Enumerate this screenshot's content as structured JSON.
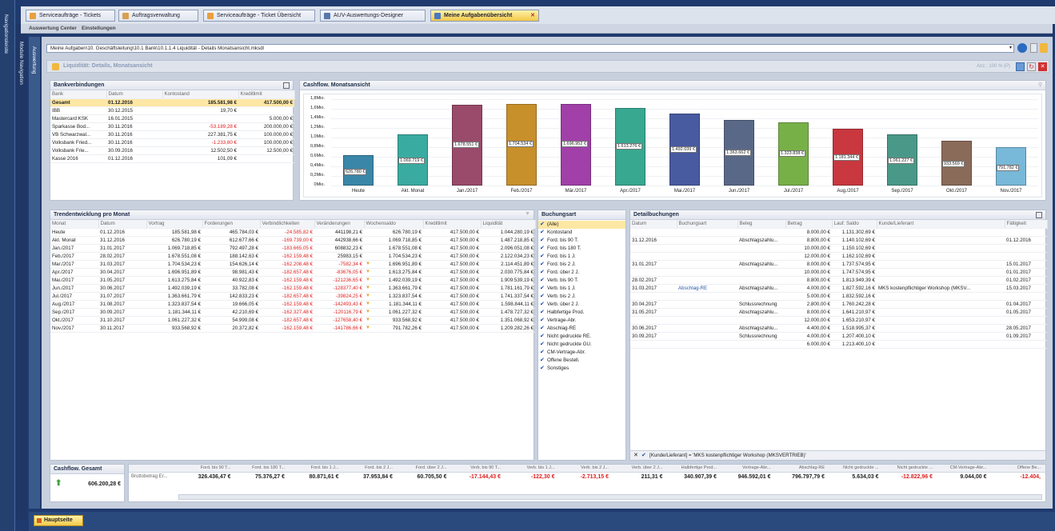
{
  "tabs": [
    {
      "label": "Serviceaufträge - Tickets",
      "color": "#e8a040"
    },
    {
      "label": "Auftragsverwaltung",
      "color": "#d8a050"
    },
    {
      "label": "Serviceaufträge - Ticket Übersicht",
      "color": "#e8a040"
    },
    {
      "label": "AUV-Auswertungs-Designer",
      "color": "#5577aa"
    },
    {
      "label": "Meine Aufgabenübersicht",
      "color": "#4a78c0"
    }
  ],
  "menu": [
    "Auswertung Center",
    "Einstellungen"
  ],
  "side": {
    "left": "Navigationsleiste",
    "mid": "Module Navigation",
    "inner": "Auswertung"
  },
  "path": "Meine Aufgaben\\10. Geschäftsleitung\\10.1 Bank\\10.1.1.4 Liquidität - Details Monatsansicht.mksdl",
  "report_title": "Liquidität: Details, Monatsansicht",
  "toolbar_zoom": "Anz.: 100 % (P)",
  "bank": {
    "title": "Bankverbindungen",
    "cols": [
      "Bank",
      "Datum",
      "Kontostand",
      "Kreditlimit"
    ],
    "rows": [
      [
        "Gesamt",
        "01.12.2016",
        "185.581,98 €",
        "417.500,00 €"
      ],
      [
        "IBB",
        "30.12.2015",
        "19,70 €",
        ""
      ],
      [
        "Mastercard KSK",
        "16.01.2015",
        "",
        "5.000,00 €"
      ],
      [
        "Sparkasse Bod...",
        "30.11.2016",
        "-53.189,28 €",
        "200.000,00 €"
      ],
      [
        "VB Schwarzwal...",
        "30.11.2016",
        "227.381,75 €",
        "100.000,00 €"
      ],
      [
        "Volksbank Fried...",
        "30.11.2016",
        "-1.233,60 €",
        "100.000,00 €"
      ],
      [
        "Volksbank Frie...",
        "30.09.2016",
        "12.502,50 €",
        "12.500,00 €"
      ],
      [
        "Kasse 2016",
        "01.12.2016",
        "101,09 €",
        ""
      ]
    ]
  },
  "chart_data": {
    "type": "bar",
    "title": "Cashflow. Monatsansicht",
    "categories": [
      "Heute",
      "Akt. Monat",
      "Jan./2017",
      "Feb./2017",
      "Mär./2017",
      "Apr./2017",
      "Mai./2017",
      "Jun./2017",
      "Jul./2017",
      "Aug./2017",
      "Sep./2017",
      "Okt./2017",
      "Nov./2017"
    ],
    "values": [
      626780,
      1069719,
      1678551,
      1704534,
      1696952,
      1613276,
      1492039,
      1363662,
      1323838,
      1181344,
      1061227,
      933569,
      791782
    ],
    "labels": [
      "626.780 €",
      "1.069.719 €",
      "1.678.551 €",
      "1.704.534 €",
      "1.696.952 €",
      "1.613.276 €",
      "1.492.039 €",
      "1.363.662 €",
      "1.323.838 €",
      "1.181.344 €",
      "1.061.227 €",
      "933.569 €",
      "791.782 €"
    ],
    "colors": [
      "#3a86a8",
      "#3aaba0",
      "#9a4a6a",
      "#c8902a",
      "#a040a8",
      "#38a890",
      "#485aa0",
      "#5a6888",
      "#78b048",
      "#c8383e",
      "#4a9888",
      "#8a6a58",
      "#78b8d8"
    ],
    "yticks": [
      "0Mio.",
      "0,2Mio.",
      "0,4Mio.",
      "0,6Mio.",
      "0,8Mio.",
      "1,0Mio.",
      "1,2Mio.",
      "1,4Mio.",
      "1,6Mio.",
      "1,8Mio."
    ],
    "ylim": [
      0,
      1800000
    ],
    "grid": true,
    "legend": "none"
  },
  "trend": {
    "title": "Trendentwicklung pro Monat",
    "cols": [
      "Monat",
      "Datum",
      "Vortrag",
      "Forderungen",
      "Verbindlichkeiten",
      "Veränderungen",
      "Wochensaldo",
      "Kreditlimit",
      "Liquidität"
    ],
    "rows": [
      [
        "Heute",
        "01.12.2016",
        "185.581,98 €",
        "465.784,03 €",
        "-24.585,82 €",
        "441198,21 €",
        "626.780,19 €",
        "417.500,00 €",
        "1.044.280,19 €"
      ],
      [
        "Akt. Monat",
        "31.12.2016",
        "626.780,19 €",
        "612.677,66 €",
        "-169.739,00 €",
        "442938,66 €",
        "1.069.718,85 €",
        "417.500,00 €",
        "1.487.218,85 €"
      ],
      [
        "Jan./2017",
        "31.01.2017",
        "1.069.718,85 €",
        "792.497,28 €",
        "-183.665,05 €",
        "608832,23 €",
        "1.678.551,08 €",
        "417.500,00 €",
        "2.096.051,08 €"
      ],
      [
        "Feb./2017",
        "28.02.2017",
        "1.678.551,08 €",
        "188.142,63 €",
        "-162.159,48 €",
        "25983,15 €",
        "1.704.534,23 €",
        "417.500,00 €",
        "2.122.034,23 €"
      ],
      [
        "Mar./2017",
        "31.03.2017",
        "1.704.534,23 €",
        "154.626,14 €",
        "-162.208,48 €",
        "-7582,34 €",
        "1.696.951,89 €",
        "417.500,00 €",
        "2.114.451,89 €"
      ],
      [
        "Apr./2017",
        "30.04.2017",
        "1.696.951,89 €",
        "98.981,43 €",
        "-182.657,48 €",
        "-83676,05 €",
        "1.613.275,84 €",
        "417.500,00 €",
        "2.030.775,84 €"
      ],
      [
        "Mai./2017",
        "31.05.2017",
        "1.613.275,84 €",
        "40.922,83 €",
        "-162.159,48 €",
        "-121236,65 €",
        "1.492.039,19 €",
        "417.500,00 €",
        "1.909.539,19 €"
      ],
      [
        "Jun./2017",
        "30.06.2017",
        "1.492.039,19 €",
        "33.782,08 €",
        "-162.159,48 €",
        "-128377,40 €",
        "1.363.661,79 €",
        "417.500,00 €",
        "1.781.161,79 €"
      ],
      [
        "Jul./2017",
        "31.07.2017",
        "1.363.661,79 €",
        "142.833,23 €",
        "-182.657,48 €",
        "-39824,25 €",
        "1.323.837,54 €",
        "417.500,00 €",
        "1.741.337,54 €"
      ],
      [
        "Aug./2017",
        "31.08.2017",
        "1.323.837,54 €",
        "19.666,05 €",
        "-162.159,48 €",
        "-142493,43 €",
        "1.181.344,11 €",
        "417.500,00 €",
        "1.598.844,11 €"
      ],
      [
        "Sep./2017",
        "30.09.2017",
        "1.181.344,11 €",
        "42.210,69 €",
        "-162.327,48 €",
        "-120116,79 €",
        "1.061.227,32 €",
        "417.500,00 €",
        "1.478.727,32 €"
      ],
      [
        "Okt./2017",
        "31.10.2017",
        "1.061.227,32 €",
        "54.999,08 €",
        "-182.657,48 €",
        "-127658,40 €",
        "933.568,92 €",
        "417.500,00 €",
        "1.351.068,92 €"
      ],
      [
        "Nov./2017",
        "30.11.2017",
        "933.568,92 €",
        "20.372,82 €",
        "-162.159,48 €",
        "-141786,66 €",
        "791.782,26 €",
        "417.500,00 €",
        "1.209.282,26 €"
      ]
    ]
  },
  "buchungsart": {
    "title": "Buchungsart",
    "items": [
      "(Alle)",
      "Kontostand",
      "Ford. bis 90 T.",
      "Ford. bis 180 T.",
      "Ford. bis 1 J.",
      "Ford. bis 2 J.",
      "Ford. über 2 J.",
      "Verb. bis 90 T.",
      "Verb. bis 1 J.",
      "Verb. bis 2 J.",
      "Verb. über 2 J.",
      "Halbfertige Prod.",
      "Vertrage-Abr.",
      "Abschlag-RE",
      "Nicht gedruckte RE.",
      "Nicht gedruckte GU.",
      "CM-Vertrage-Abr.",
      "Offene Bestell.",
      "Sonstiges"
    ]
  },
  "detail": {
    "title": "Detailbuchungen",
    "cols": [
      "Datum",
      "Buchungsart",
      "Beleg",
      "Betrag",
      "Lauf. Saldo",
      "Kunde/Lieferant",
      "Fälligkeit"
    ],
    "rows": [
      [
        "",
        "",
        "",
        "8.000,00 €",
        "1.131.302,69 €",
        "",
        ""
      ],
      [
        "31.12.2016",
        "",
        "Abschlagszahlu...",
        "8.800,00 €",
        "1.140.102,69 €",
        "",
        "01.12.2016"
      ],
      [
        "",
        "",
        "",
        "10.000,00 €",
        "1.150.102,69 €",
        "",
        ""
      ],
      [
        "",
        "",
        "",
        "12.000,00 €",
        "1.162.102,69 €",
        "",
        ""
      ],
      [
        "31.01.2017",
        "",
        "Abschlagszahlu...",
        "8.000,00 €",
        "1.737.574,95 €",
        "",
        "15.01.2017"
      ],
      [
        "",
        "",
        "",
        "10.000,00 €",
        "1.747.574,95 €",
        "",
        "01.01.2017"
      ],
      [
        "28.02.2017",
        "",
        "",
        "8.800,00 €",
        "1.813.949,39 €",
        "",
        "01.02.2017"
      ],
      [
        "31.03.2017",
        "Abschlag-RE",
        "Abschlagszahlu...",
        "4.000,00 €",
        "1.827.592,16 €",
        "MKS kostenpflichtiger Workshop (MKSV...",
        "15.03.2017"
      ],
      [
        "",
        "",
        "",
        "5.000,00 €",
        "1.832.592,16 €",
        "",
        ""
      ],
      [
        "30.04.2017",
        "",
        "Schlussrechnung",
        "2.800,00 €",
        "1.760.242,28 €",
        "",
        "01.04.2017"
      ],
      [
        "31.05.2017",
        "",
        "Abschlagszahlu...",
        "8.000,00 €",
        "1.641.210,97 €",
        "",
        "01.05.2017"
      ],
      [
        "",
        "",
        "",
        "12.000,00 €",
        "1.653.210,97 €",
        "",
        ""
      ],
      [
        "30.06.2017",
        "",
        "Abschlagszahlu...",
        "4.400,00 €",
        "1.518.995,37 €",
        "",
        "28.05.2017"
      ],
      [
        "30.09.2017",
        "",
        "Schlussrechnung",
        "4.000,00 €",
        "1.207.400,10 €",
        "",
        "01.09.2017"
      ],
      [
        "",
        "",
        "",
        "6.000,00 €",
        "1.213.400,10 €",
        "",
        ""
      ]
    ],
    "filter": "[Kunde/Lieferant] = 'MKS kostenpflichtiger Workshop (MKSVERTRIEB)'"
  },
  "cashflow_total": {
    "title": "Cashflow. Gesamt",
    "value": "606.200,28 €"
  },
  "summary": {
    "row_label": "Bruttobetrag Er...",
    "cols": [
      "Ford. bis 90 T...",
      "Ford. bis 180 T...",
      "Ford. bis 1 J...",
      "Ford. bis 2 J...",
      "Ford. über 2 J...",
      "Verb. bis 90 T...",
      "Verb. bis 1 J...",
      "Verb. bis 2 J...",
      "Verb. über 2 J...",
      "Halbfertige Prod...",
      "Vertrage-Abr...",
      "Abschlag-RE",
      "Nicht gedruckte ...",
      "Nicht gedruckte ...",
      "CM-Vertrage-Abr...",
      "Offene Be..."
    ],
    "values": [
      "326.436,47 €",
      "75.376,27 €",
      "80.871,61 €",
      "37.953,84 €",
      "60.705,50 €",
      "-17.144,43 €",
      "-122,30 €",
      "-2.713,15 €",
      "211,31 €",
      "340.907,39 €",
      "946.592,01 €",
      "796.797,79 €",
      "5.634,03 €",
      "-12.822,96 €",
      "9.044,00 €",
      "-12.404,"
    ]
  },
  "bottom_tab": "Hauptseite"
}
